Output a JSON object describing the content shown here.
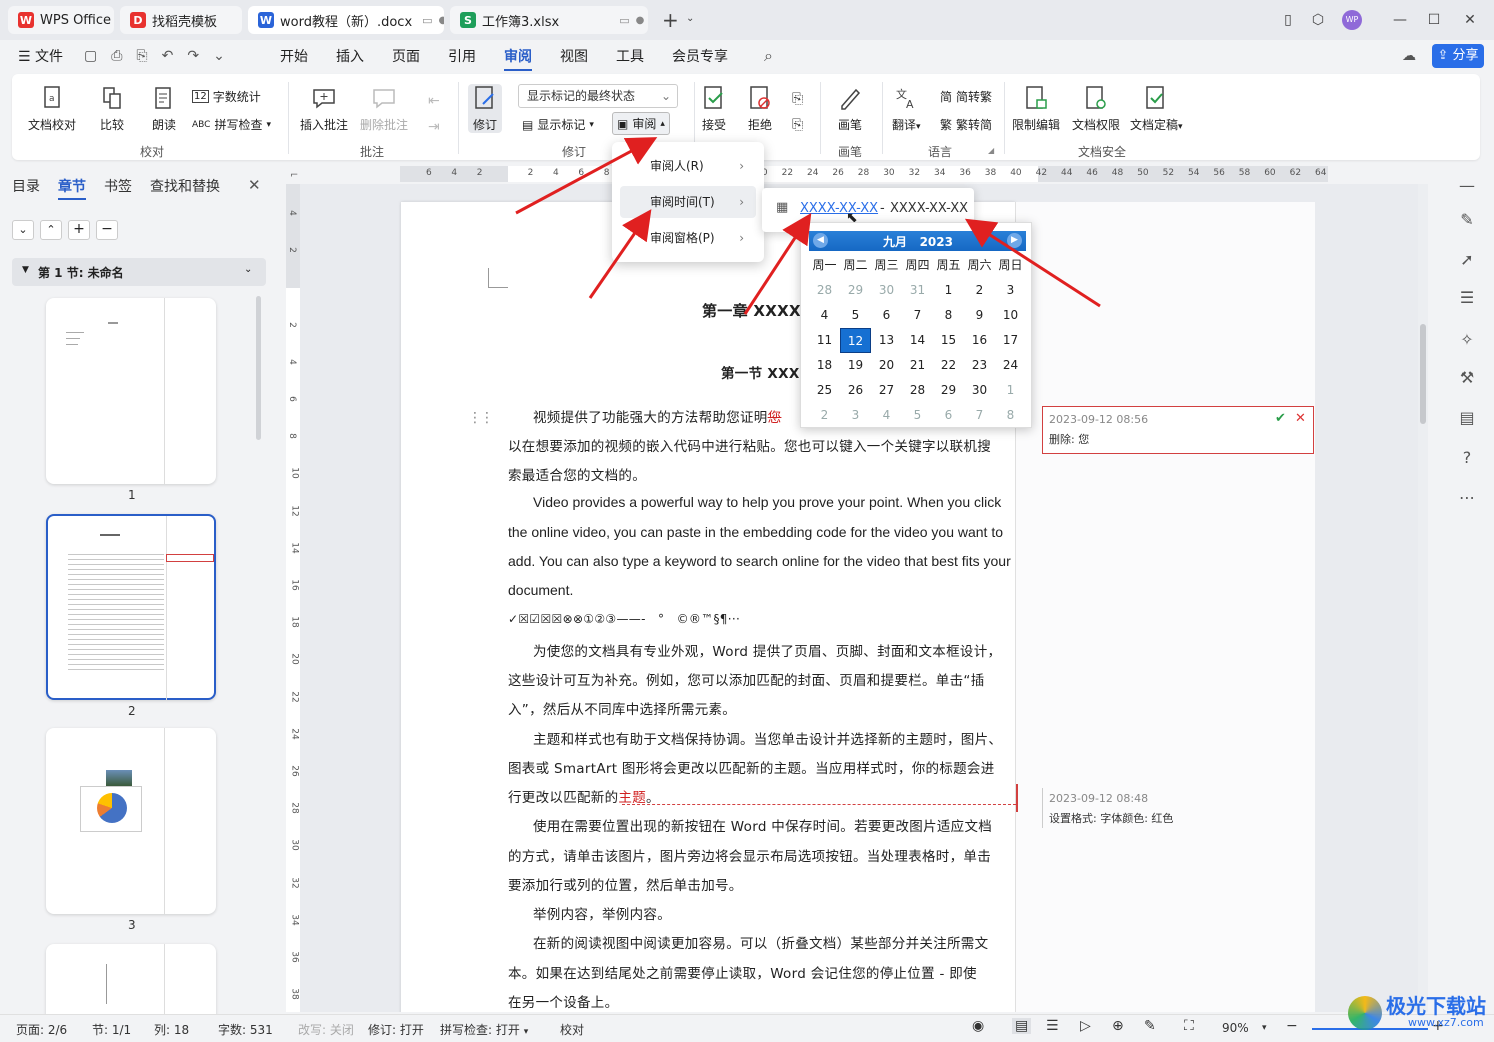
{
  "tabs": [
    {
      "label": "WPS Office",
      "icon": "W"
    },
    {
      "label": "找稻壳模板",
      "icon": "D"
    },
    {
      "label": "word教程（新）.docx",
      "icon": "W"
    },
    {
      "label": "工作簿3.xlsx",
      "icon": "S"
    }
  ],
  "user_avatar": "WP",
  "menu": {
    "file": "文件",
    "items": [
      "开始",
      "插入",
      "页面",
      "引用",
      "审阅",
      "视图",
      "工具",
      "会员专享"
    ],
    "active": "审阅",
    "share": "分享"
  },
  "ribbon": {
    "check": {
      "doc_check": "文档校对",
      "compare": "比较",
      "read": "朗读",
      "word_count": "字数统计",
      "spell": "拼写检查",
      "group": "校对"
    },
    "comment": {
      "insert": "插入批注",
      "delete": "删除批注",
      "group": "批注"
    },
    "revision": {
      "revise": "修订",
      "display_state": "显示标记的最终状态",
      "show_marks": "显示标记",
      "review": "审阅",
      "group": "修订"
    },
    "changes": {
      "accept": "接受",
      "reject": "拒绝"
    },
    "pen": {
      "label": "画笔",
      "group": "画笔"
    },
    "lang": {
      "translate": "翻译",
      "to_trad": "简转繁",
      "to_simp": "繁转简",
      "group": "语言"
    },
    "security": {
      "restrict": "限制编辑",
      "rights": "文档权限",
      "finalize": "文档定稿",
      "group": "文档安全"
    }
  },
  "nav": {
    "tabs": [
      "目录",
      "章节",
      "书签",
      "查找和替换"
    ],
    "active": "章节",
    "section": "第 1 节: 未命名",
    "page_numbers": [
      "1",
      "2",
      "3"
    ]
  },
  "ruler_h": [
    "6",
    "4",
    "2",
    "",
    "2",
    "4",
    "6",
    "8",
    "10",
    "12",
    "14",
    "16",
    "18",
    "20",
    "22",
    "24",
    "26",
    "28",
    "30",
    "32",
    "34",
    "36",
    "38",
    "40",
    "42",
    "44",
    "46",
    "48",
    "50",
    "52",
    "54",
    "56",
    "58",
    "60",
    "62",
    "64"
  ],
  "ruler_v": [
    "4",
    "2",
    "",
    "2",
    "4",
    "6",
    "8",
    "10",
    "12",
    "14",
    "16",
    "18",
    "20",
    "22",
    "24",
    "26",
    "28",
    "30",
    "32",
    "34",
    "36",
    "38"
  ],
  "doc": {
    "chapter": "第一章 XXXX",
    "section": "第一节 XXX",
    "p1a": "视频提供了功能强大的方法帮助您证明",
    "p1_del": "您",
    "p1b": "以在想要添加的视频的嵌入代码中进行粘贴。您也可以键入一个关键字以联机搜",
    "p1c": "索最适合您的文档的。",
    "en1": "Video provides a powerful way to help you prove your point. When you click",
    "en2": "the online video, you can paste in the embedding code for the video you want to",
    "en3": "add. You can also type a keyword to search online for the video that best fits your",
    "en4": "document.",
    "symbols": "✓☒☑☒☒⊗⊗①②③——-　°　©®™§¶···",
    "p2a": "为使您的文档具有专业外观，Word 提供了页眉、页脚、封面和文本框设计，",
    "p2b": "这些设计可互为补充。例如，您可以添加匹配的封面、页眉和提要栏。单击“插",
    "p2c": "入”，然后从不同库中选择所需元素。",
    "p3a": "主题和样式也有助于文档保持协调。当您单击设计并选择新的主题时，图片、",
    "p3b": "图表或 SmartArt 图形将会更改以匹配新的主题。当应用样式时，你的标题会进",
    "p3c": "行更改以匹配新的",
    "p3_red": "主题",
    "p3d": "。",
    "p4a": "使用在需要位置出现的新按钮在 Word 中保存时间。若要更改图片适应文档",
    "p4b": "的方式，请单击该图片，图片旁边将会显示布局选项按钮。当处理表格时，单击",
    "p4c": "要添加行或列的位置，然后单击加号。",
    "p5": "举例内容，举例内容。",
    "p6a": "在新的阅读视图中阅读更加容易。可以（折叠文档）某些部分并关注所需文",
    "p6b": "本。如果在达到结尾处之前需要停止读取，Word 会记住您的停止位置 - 即使",
    "p6c": "在另一个设备上。"
  },
  "comments": [
    {
      "time": "2023-09-12 08:56",
      "text": "删除: 您"
    },
    {
      "time": "2023-09-12 08:48",
      "text": "设置格式: 字体颜色: 红色"
    }
  ],
  "dropdown": {
    "items": [
      "审阅人(R)",
      "审阅时间(T)",
      "审阅窗格(P)"
    ],
    "active": "审阅时间(T)"
  },
  "daterange": {
    "start": "XXXX-XX-XX",
    "sep": "-",
    "end": "XXXX-XX-XX"
  },
  "calendar": {
    "month": "九月",
    "year": "2023",
    "weekdays": [
      "周一",
      "周二",
      "周三",
      "周四",
      "周五",
      "周六",
      "周日"
    ],
    "days": [
      [
        "28",
        "29",
        "30",
        "31",
        "1",
        "2",
        "3"
      ],
      [
        "4",
        "5",
        "6",
        "7",
        "8",
        "9",
        "10"
      ],
      [
        "11",
        "12",
        "13",
        "14",
        "15",
        "16",
        "17"
      ],
      [
        "18",
        "19",
        "20",
        "21",
        "22",
        "23",
        "24"
      ],
      [
        "25",
        "26",
        "27",
        "28",
        "29",
        "30",
        "1"
      ],
      [
        "2",
        "3",
        "4",
        "5",
        "6",
        "7",
        "8"
      ]
    ],
    "selected": "12"
  },
  "status": {
    "page": "页面: 2/6",
    "section": "节: 1/1",
    "col": "列: 18",
    "words": "字数: 531",
    "overtype": "改写: 关闭",
    "revise": "修订: 打开",
    "spell": "拼写检查: 打开",
    "proof": "校对",
    "zoom": "90%"
  },
  "watermark": "极光下载站",
  "watermark_url": "www.xz7.com"
}
